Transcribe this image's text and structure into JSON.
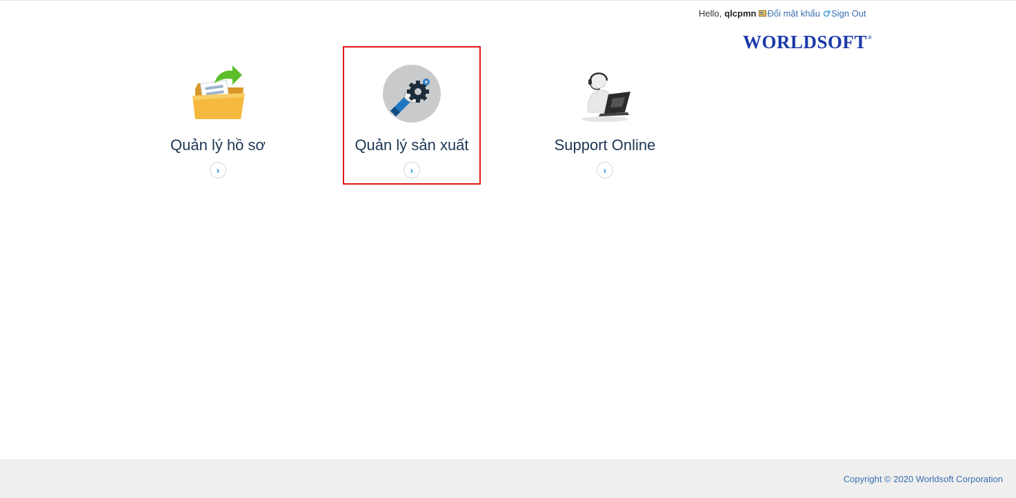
{
  "userbar": {
    "greeting": "Hello,",
    "username": "qlcpmn",
    "change_password": "Đổi mật khẩu",
    "sign_out": "Sign Out"
  },
  "brand": {
    "name": "WORLDSOFT",
    "mark": "®"
  },
  "modules": [
    {
      "title": "Quản lý hồ sơ",
      "icon": "folder-icon",
      "selected": false
    },
    {
      "title": "Quản lý sản xuất",
      "icon": "gear-hand-icon",
      "selected": true
    },
    {
      "title": "Support Online",
      "icon": "support-agent-icon",
      "selected": false
    }
  ],
  "footer": {
    "copyright": "Copyright © 2020 Worldsoft Corporation"
  },
  "colors": {
    "brand": "#1c3aa9",
    "link": "#3a6fb0",
    "selection_border": "#e01414",
    "arrow": "#1e8fd0"
  }
}
